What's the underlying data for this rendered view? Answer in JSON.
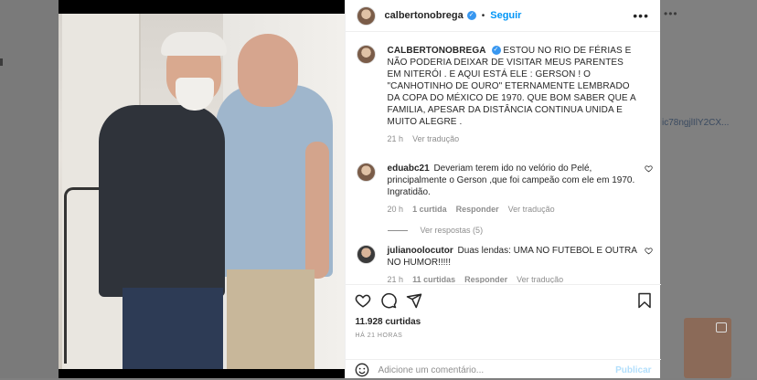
{
  "post": {
    "author": "calbertonobrega",
    "follow_label": "Seguir",
    "separator": "•",
    "more": "•••"
  },
  "caption": {
    "username": "calbertonobrega",
    "text": "ESTOU NO RIO DE FÉRIAS E NÃO PODERIA DEIXAR DE VISITAR MEUS PARENTES EM NITERÓI . E AQUI ESTÁ ELE : GERSON ! O \"CANHOTINHO DE OURO\" ETERNAMENTE LEMBRADO DA COPA DO MÉXICO DE 1970. QUE BOM SABER QUE A FAMILIA, APESAR DA DISTÂNCIA CONTINUA UNIDA E MUITO ALEGRE .",
    "time": "21 h",
    "translate": "Ver tradução"
  },
  "comments": [
    {
      "username": "eduabc21",
      "text": "Deveriam terem ido no velório do Pelé, principalmente o Gerson ,que foi campeão com ele em 1970. Ingratidão.",
      "time": "20 h",
      "likes": "1 curtida",
      "reply": "Responder",
      "translate": "Ver tradução",
      "view_replies": "Ver respostas (5)"
    },
    {
      "username": "julianoolocutor",
      "text": "Duas lendas: UMA NO FUTEBOL E OUTRA NO HUMOR!!!!!",
      "time": "21 h",
      "likes": "11 curtidas",
      "reply": "Responder",
      "translate": "Ver tradução"
    }
  ],
  "stats": {
    "likes": "11.928 curtidas",
    "date": "HÁ 21 HORAS"
  },
  "composer": {
    "placeholder": "Adicione um comentário...",
    "publish": "Publicar"
  },
  "background": {
    "dots": "•••",
    "link_fragment": "ic78ngjlIlY2CX..."
  },
  "colors": {
    "accent": "#0095f6",
    "verified": "#3897f0",
    "muted": "#8e8e8e",
    "publish_disabled": "#b2dffc"
  },
  "icons": [
    "heart-icon",
    "comment-icon",
    "share-icon",
    "bookmark-icon",
    "emoji-icon",
    "more-icon",
    "verified-icon"
  ]
}
